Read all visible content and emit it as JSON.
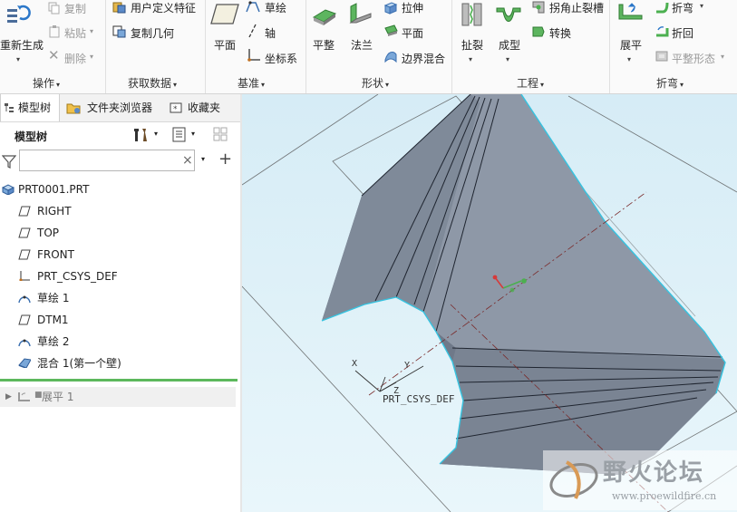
{
  "ribbon": {
    "groups": [
      {
        "label": "操作",
        "dropdown": "▾"
      },
      {
        "label": "获取数据",
        "dropdown": "▾"
      },
      {
        "label": "基准",
        "dropdown": "▾"
      },
      {
        "label": "形状",
        "dropdown": "▾"
      },
      {
        "label": "工程",
        "dropdown": "▾"
      },
      {
        "label": "折弯",
        "dropdown": "▾"
      }
    ],
    "operations": {
      "regenerate": "重新生成",
      "copy": "复制",
      "paste": "粘贴",
      "delete": "删除"
    },
    "get_data": {
      "udf": "用户定义特征",
      "copy_geometry": "复制几何"
    },
    "datum": {
      "plane": "平面",
      "sketch": "草绘",
      "axis": "轴",
      "csys": "坐标系"
    },
    "shapes": {
      "flat": "平整",
      "flange": "法兰",
      "extrude": "拉伸",
      "plane": "平面",
      "boundary_blend": "边界混合"
    },
    "engineering": {
      "rip": "扯裂",
      "form": "成型",
      "corner_relief": "拐角止裂槽",
      "convert": "转换"
    },
    "bend": {
      "unbend": "展平",
      "bend": "折弯",
      "bend_back": "折回",
      "flat_pattern": "平整形态"
    }
  },
  "tabs": [
    "模型树",
    "文件夹浏览器",
    "收藏夹"
  ],
  "tree_header": {
    "title": "模型树",
    "search_placeholder": "",
    "clear": "×",
    "add": "+"
  },
  "tree_items": [
    {
      "label": "PRT0001.PRT",
      "icon": "part-icon"
    },
    {
      "label": "RIGHT",
      "icon": "datum-plane-icon"
    },
    {
      "label": "TOP",
      "icon": "datum-plane-icon"
    },
    {
      "label": "FRONT",
      "icon": "datum-plane-icon"
    },
    {
      "label": "PRT_CSYS_DEF",
      "icon": "csys-icon"
    },
    {
      "label": "草绘 1",
      "icon": "sketch-icon"
    },
    {
      "label": "DTM1",
      "icon": "datum-plane-icon"
    },
    {
      "label": "草绘 2",
      "icon": "sketch-icon"
    },
    {
      "label": "混合 1(第一个壁)",
      "icon": "blend-icon"
    }
  ],
  "suppressed_item": {
    "label": "展平 1",
    "icon": "unbend-icon"
  },
  "viewport": {
    "csys_label": "PRT_CSYS_DEF",
    "axis_x": "X",
    "axis_y": "Y",
    "axis_z": "Z",
    "watermark_title": "野火论坛",
    "watermark_url": "www.proewildfire.cn"
  },
  "colors": {
    "accent_green": "#4cb050",
    "surface_dark": "#6c7685",
    "surface_light": "#8f99a8",
    "edge_cyan": "#36c3e0",
    "viewport_bg": "#dcf0f8"
  }
}
